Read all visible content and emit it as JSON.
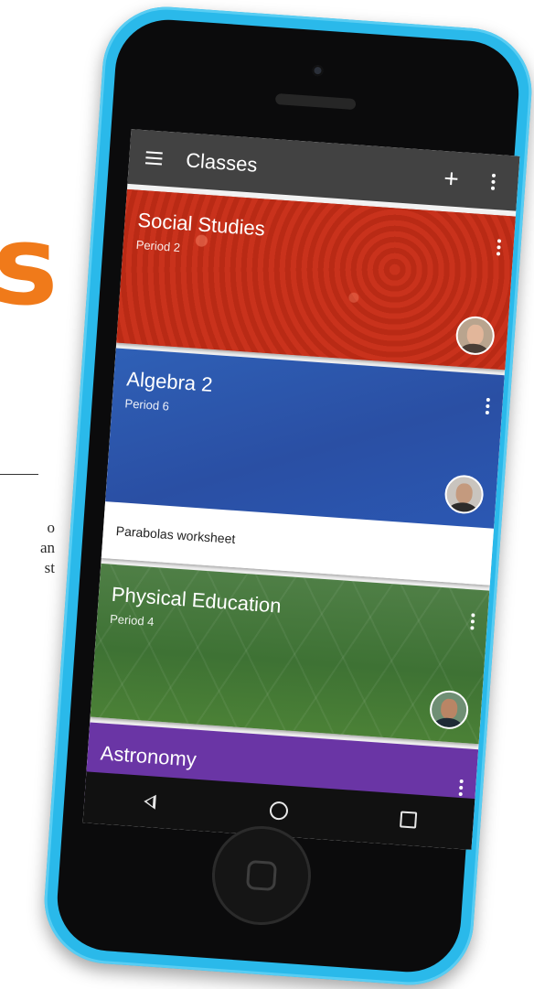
{
  "background": {
    "big_letter": "s",
    "big_letter_color": "#f07a1a",
    "text_fragments": [
      "o",
      "an",
      "st"
    ]
  },
  "phone": {
    "frame_color": "#2ab9ea"
  },
  "appbar": {
    "title": "Classes",
    "menu_icon": "hamburger-icon",
    "add_icon": "plus-icon",
    "overflow_icon": "more-vert-icon",
    "add_glyph": "+"
  },
  "classes": [
    {
      "name": "Social Studies",
      "period": "Period 2",
      "color": "#c0301b",
      "teacher_avatar": "avatar",
      "footer": ""
    },
    {
      "name": "Algebra 2",
      "period": "Period 6",
      "color": "#2f60b6",
      "teacher_avatar": "avatar",
      "footer": "Parabolas worksheet"
    },
    {
      "name": "Physical Education",
      "period": "Period 4",
      "color": "#3e7234",
      "teacher_avatar": "avatar",
      "footer": ""
    },
    {
      "name": "Astronomy",
      "period": "",
      "color": "#6a35a5",
      "teacher_avatar": "",
      "footer": ""
    }
  ],
  "navbar": {
    "back_icon": "back-triangle-icon",
    "home_icon": "home-circle-icon",
    "recents_icon": "recents-square-icon"
  }
}
